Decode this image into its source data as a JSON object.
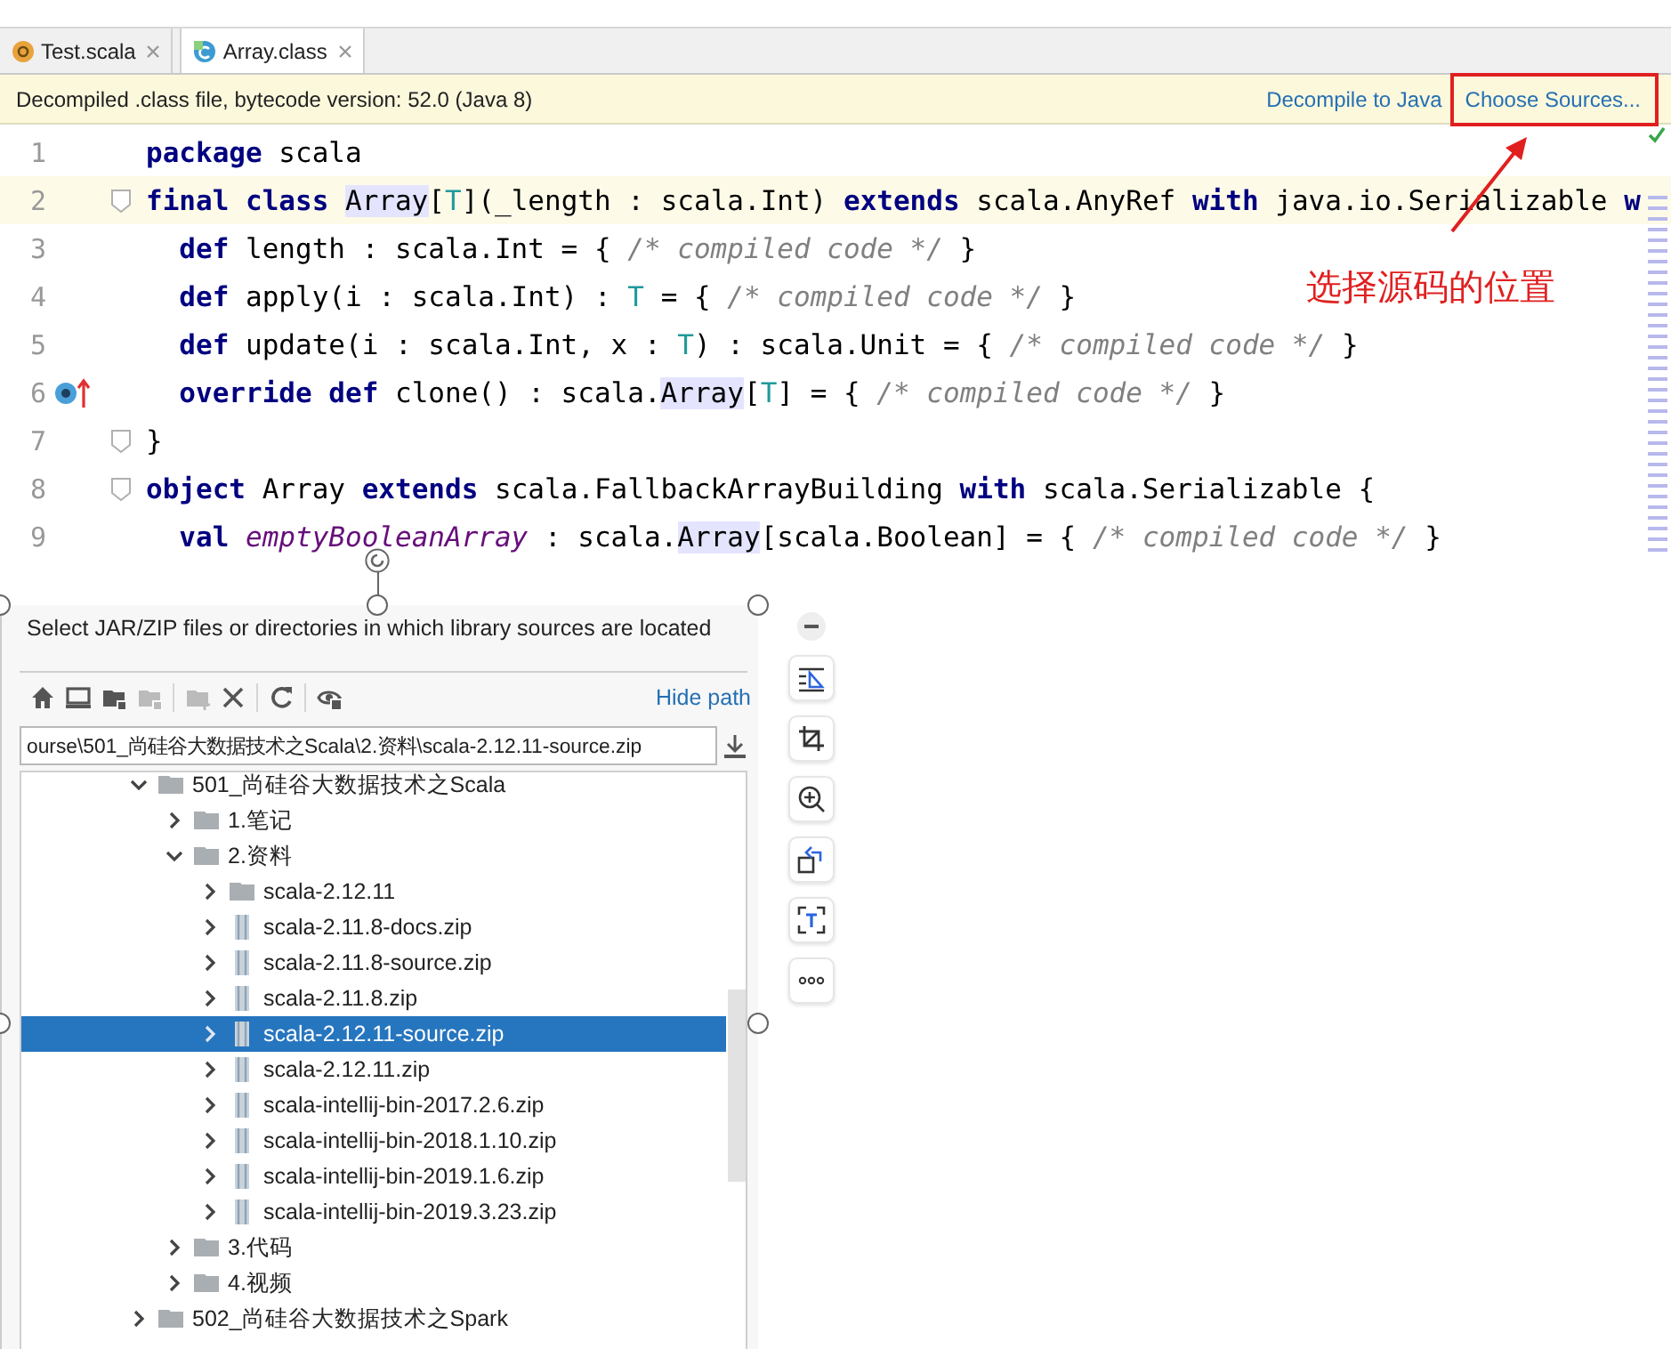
{
  "tabs": [
    {
      "label": "Test.scala",
      "selected": false,
      "kind": "scala"
    },
    {
      "label": "Array.class",
      "selected": true,
      "kind": "class"
    }
  ],
  "banner": {
    "message": "Decompiled .class file, bytecode version: 52.0 (Java 8)",
    "links": [
      "Decompile to Java",
      "Choose Sources..."
    ]
  },
  "code_lines": [
    {
      "number": "1",
      "current": false,
      "fold": false,
      "override_mark": false,
      "tokens": [
        {
          "text": "package",
          "kind": "kw"
        },
        {
          "text": " scala",
          "kind": "text"
        }
      ]
    },
    {
      "number": "2",
      "current": true,
      "fold": true,
      "override_mark": false,
      "tokens": [
        {
          "text": "final class ",
          "kind": "kw"
        },
        {
          "text": "Array",
          "kind": "ref"
        },
        {
          "text": "[",
          "kind": "text"
        },
        {
          "text": "T",
          "kind": "tparam"
        },
        {
          "text": "](_length : scala.Int) ",
          "kind": "text"
        },
        {
          "text": "extends",
          "kind": "kw"
        },
        {
          "text": " scala.AnyRef ",
          "kind": "text"
        },
        {
          "text": "with",
          "kind": "kw"
        },
        {
          "text": " java.io.Serializable ",
          "kind": "text"
        },
        {
          "text": "w",
          "kind": "kw"
        }
      ]
    },
    {
      "number": "3",
      "current": false,
      "fold": false,
      "override_mark": false,
      "tokens": [
        {
          "text": "  def",
          "kind": "kw"
        },
        {
          "text": " length : scala.Int = { ",
          "kind": "text"
        },
        {
          "text": "/* compiled code */",
          "kind": "comment"
        },
        {
          "text": " }",
          "kind": "text"
        }
      ]
    },
    {
      "number": "4",
      "current": false,
      "fold": false,
      "override_mark": false,
      "tokens": [
        {
          "text": "  def",
          "kind": "kw"
        },
        {
          "text": " apply(i : scala.Int) : ",
          "kind": "text"
        },
        {
          "text": "T",
          "kind": "tparam"
        },
        {
          "text": " = { ",
          "kind": "text"
        },
        {
          "text": "/* compiled code */",
          "kind": "comment"
        },
        {
          "text": " }",
          "kind": "text"
        }
      ]
    },
    {
      "number": "5",
      "current": false,
      "fold": false,
      "override_mark": false,
      "tokens": [
        {
          "text": "  def",
          "kind": "kw"
        },
        {
          "text": " update(i : scala.Int, x : ",
          "kind": "text"
        },
        {
          "text": "T",
          "kind": "tparam"
        },
        {
          "text": ") : scala.Unit = { ",
          "kind": "text"
        },
        {
          "text": "/* compiled code */",
          "kind": "comment"
        },
        {
          "text": " }",
          "kind": "text"
        }
      ]
    },
    {
      "number": "6",
      "current": false,
      "fold": false,
      "override_mark": true,
      "tokens": [
        {
          "text": "  override def",
          "kind": "kw"
        },
        {
          "text": " clone() : scala.",
          "kind": "text"
        },
        {
          "text": "Array",
          "kind": "ref"
        },
        {
          "text": "[",
          "kind": "text"
        },
        {
          "text": "T",
          "kind": "tparam"
        },
        {
          "text": "] = { ",
          "kind": "text"
        },
        {
          "text": "/* compiled code */",
          "kind": "comment"
        },
        {
          "text": " }",
          "kind": "text"
        }
      ]
    },
    {
      "number": "7",
      "current": false,
      "fold": true,
      "override_mark": false,
      "tokens": [
        {
          "text": "}",
          "kind": "text"
        }
      ]
    },
    {
      "number": "8",
      "current": false,
      "fold": true,
      "override_mark": false,
      "tokens": [
        {
          "text": "object",
          "kind": "kw"
        },
        {
          "text": " Array ",
          "kind": "text"
        },
        {
          "text": "extends",
          "kind": "kw"
        },
        {
          "text": " scala.FallbackArrayBuilding ",
          "kind": "text"
        },
        {
          "text": "with",
          "kind": "kw"
        },
        {
          "text": " scala.Serializable {",
          "kind": "text"
        }
      ]
    },
    {
      "number": "9",
      "current": false,
      "fold": false,
      "override_mark": false,
      "tokens": [
        {
          "text": "  val ",
          "kind": "kw"
        },
        {
          "text": "emptyBooleanArray",
          "kind": "field"
        },
        {
          "text": " : scala.",
          "kind": "text"
        },
        {
          "text": "Array",
          "kind": "ref"
        },
        {
          "text": "[scala.Boolean] = { ",
          "kind": "text"
        },
        {
          "text": "/* compiled code */",
          "kind": "comment"
        },
        {
          "text": " }",
          "kind": "text"
        }
      ]
    }
  ],
  "annotation": {
    "text": "选择源码的位置"
  },
  "dialog": {
    "description": "Select JAR/ZIP files or directories in which library sources are located",
    "hide_path_link": "Hide path",
    "path": "ourse\\501_尚硅谷大数据技术之Scala\\2.资料\\scala-2.12.11-source.zip",
    "tree": [
      {
        "label": "501_尚硅谷大数据技术之Scala",
        "kind": "folder",
        "expanded": true,
        "selected": false,
        "children": [
          {
            "label": "1.笔记",
            "kind": "folder",
            "expanded": false,
            "selected": false
          },
          {
            "label": "2.资料",
            "kind": "folder",
            "expanded": true,
            "selected": false,
            "children": [
              {
                "label": "scala-2.12.11",
                "kind": "folder",
                "expanded": false,
                "selected": false
              },
              {
                "label": "scala-2.11.8-docs.zip",
                "kind": "archive",
                "expanded": false,
                "selected": false
              },
              {
                "label": "scala-2.11.8-source.zip",
                "kind": "archive",
                "expanded": false,
                "selected": false
              },
              {
                "label": "scala-2.11.8.zip",
                "kind": "archive",
                "expanded": false,
                "selected": false
              },
              {
                "label": "scala-2.12.11-source.zip",
                "kind": "archive",
                "expanded": false,
                "selected": true
              },
              {
                "label": "scala-2.12.11.zip",
                "kind": "archive",
                "expanded": false,
                "selected": false
              },
              {
                "label": "scala-intellij-bin-2017.2.6.zip",
                "kind": "archive",
                "expanded": false,
                "selected": false
              },
              {
                "label": "scala-intellij-bin-2018.1.10.zip",
                "kind": "archive",
                "expanded": false,
                "selected": false
              },
              {
                "label": "scala-intellij-bin-2019.1.6.zip",
                "kind": "archive",
                "expanded": false,
                "selected": false
              },
              {
                "label": "scala-intellij-bin-2019.3.23.zip",
                "kind": "archive",
                "expanded": false,
                "selected": false
              }
            ]
          },
          {
            "label": "3.代码",
            "kind": "folder",
            "expanded": false,
            "selected": false
          },
          {
            "label": "4.视频",
            "kind": "folder",
            "expanded": false,
            "selected": false
          }
        ]
      },
      {
        "label": "502_尚硅谷大数据技术之Spark",
        "kind": "folder",
        "expanded": false,
        "selected": false
      }
    ]
  }
}
